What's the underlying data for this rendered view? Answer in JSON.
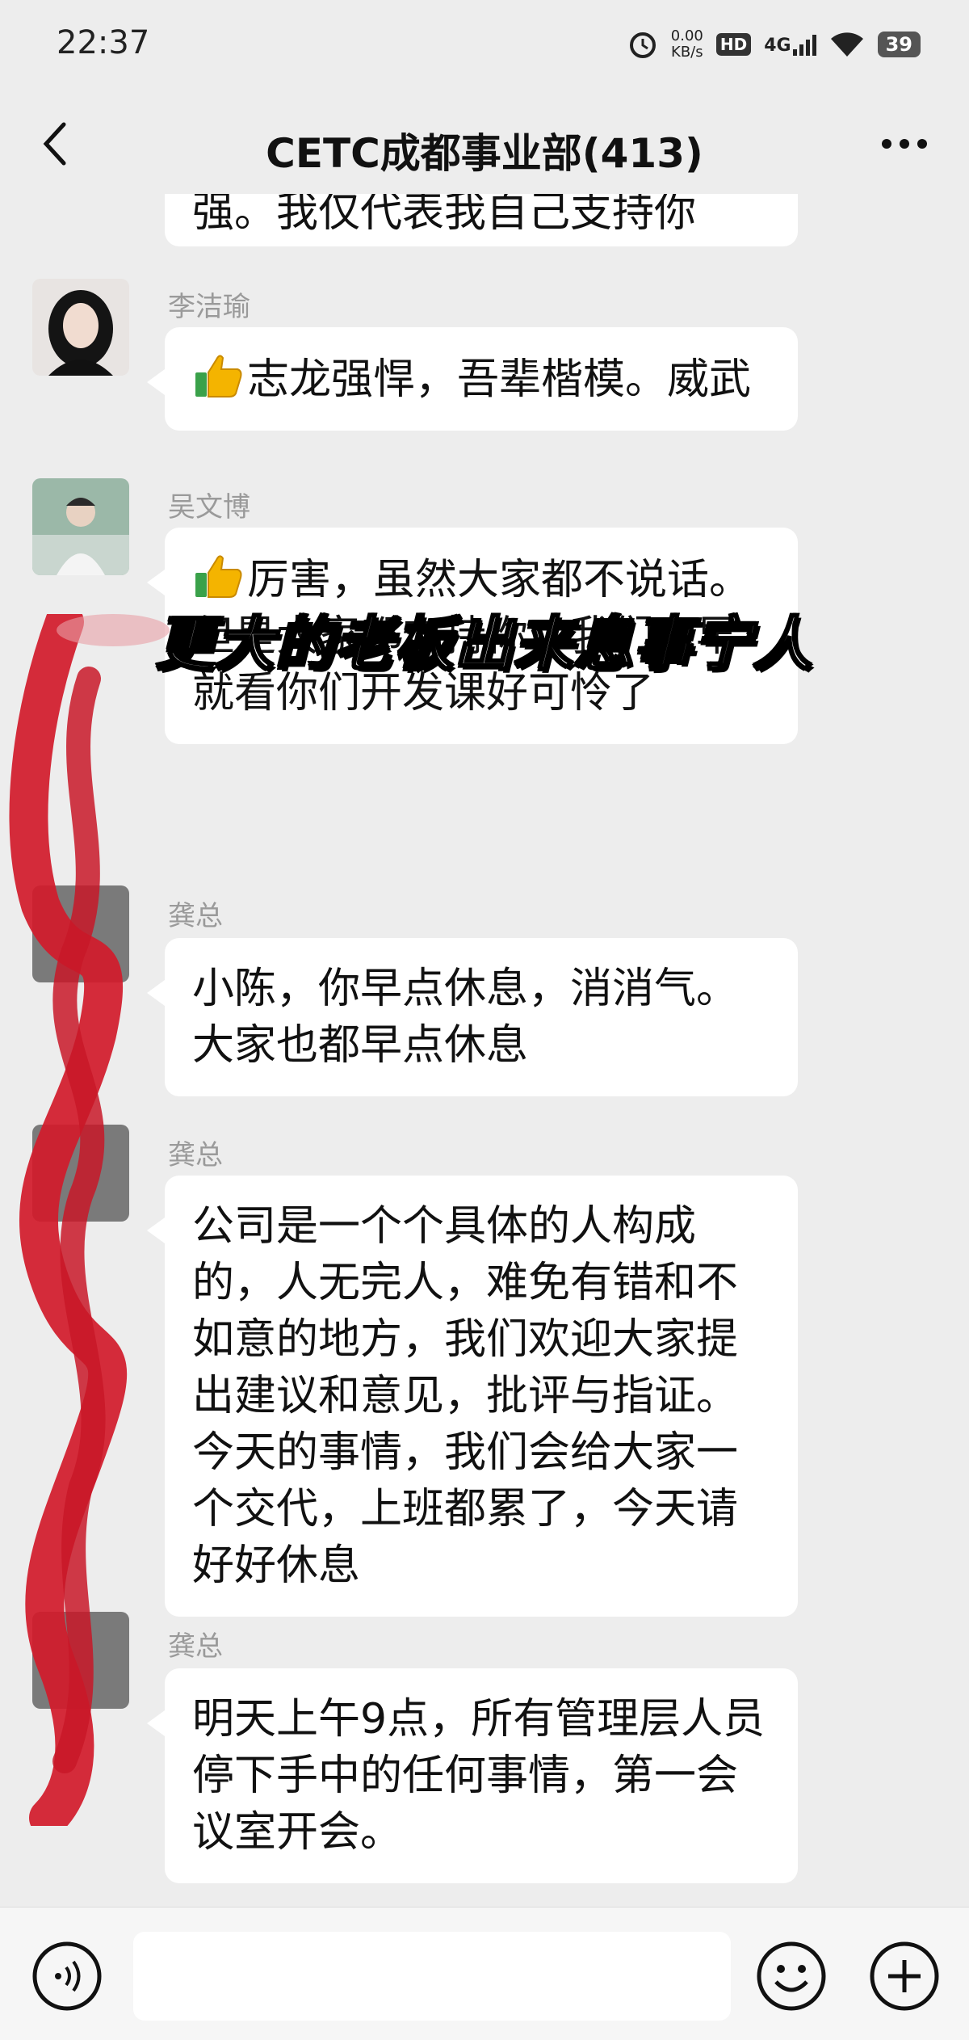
{
  "status_bar": {
    "time": "22:37",
    "speed_value": "0.00",
    "speed_unit": "KB/s",
    "hd": "HD",
    "network": "4G",
    "battery": "39"
  },
  "nav": {
    "title": "CETC成都事业部(413)"
  },
  "messages": [
    {
      "sender": "",
      "text": "强。我仅代表我自己支持你",
      "partial": true
    },
    {
      "sender": "李洁瑜",
      "emoji": "thumbs-up-icon",
      "text": "志龙强悍，吾辈楷模。威武"
    },
    {
      "sender": "吴文博",
      "emoji": "thumbs-up-icon",
      "text": "厉害，虽然大家都不说话。但是大家都支持你，我们也早就看你们开发课好可怜了"
    },
    {
      "sender": "龚总",
      "text": "小陈，你早点休息，消消气。大家也都早点休息"
    },
    {
      "sender": "龚总",
      "text": "公司是一个个具体的人构成的，人无完人，难免有错和不如意的地方，我们欢迎大家提出建议和意见，批评与指证。今天的事情，我们会给大家一个交代，上班都累了，今天请好好休息"
    },
    {
      "sender": "龚总",
      "text": "明天上午9点，所有管理层人员停下手中的任何事情，第一会议室开会。"
    }
  ],
  "overlay_caption": "更大的老板出来息事宁人",
  "input_bar": {
    "placeholder": ""
  },
  "colors": {
    "background": "#ededed",
    "bubble": "#ffffff",
    "redaction": "#d11a2a"
  }
}
